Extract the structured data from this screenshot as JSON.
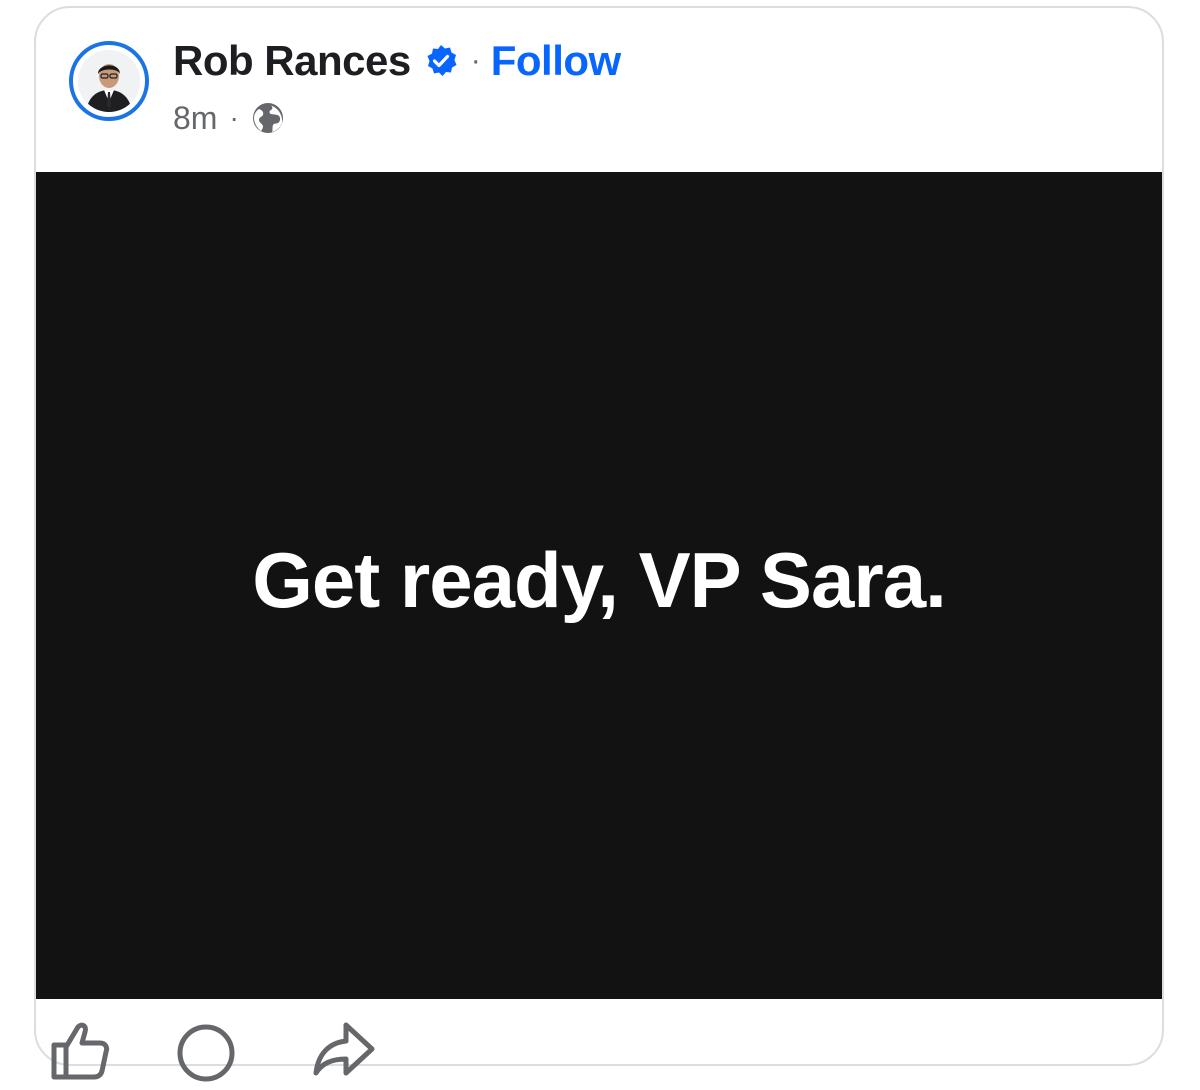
{
  "post": {
    "author_name": "Rob Rances",
    "follow_label": "Follow",
    "separator": "·",
    "timestamp": "8m",
    "audience_icon": "globe-icon",
    "verified_icon": "verified-badge-icon",
    "media_text": "Get ready, VP Sara."
  },
  "actions": {
    "icons": [
      "like-icon",
      "comment-icon",
      "share-icon"
    ]
  },
  "colors": {
    "accent": "#0866ff",
    "avatar_ring": "#1b74e4",
    "text_primary": "#1c1e21",
    "text_secondary": "#65676b",
    "media_background": "#121212",
    "media_text": "#ffffff"
  }
}
